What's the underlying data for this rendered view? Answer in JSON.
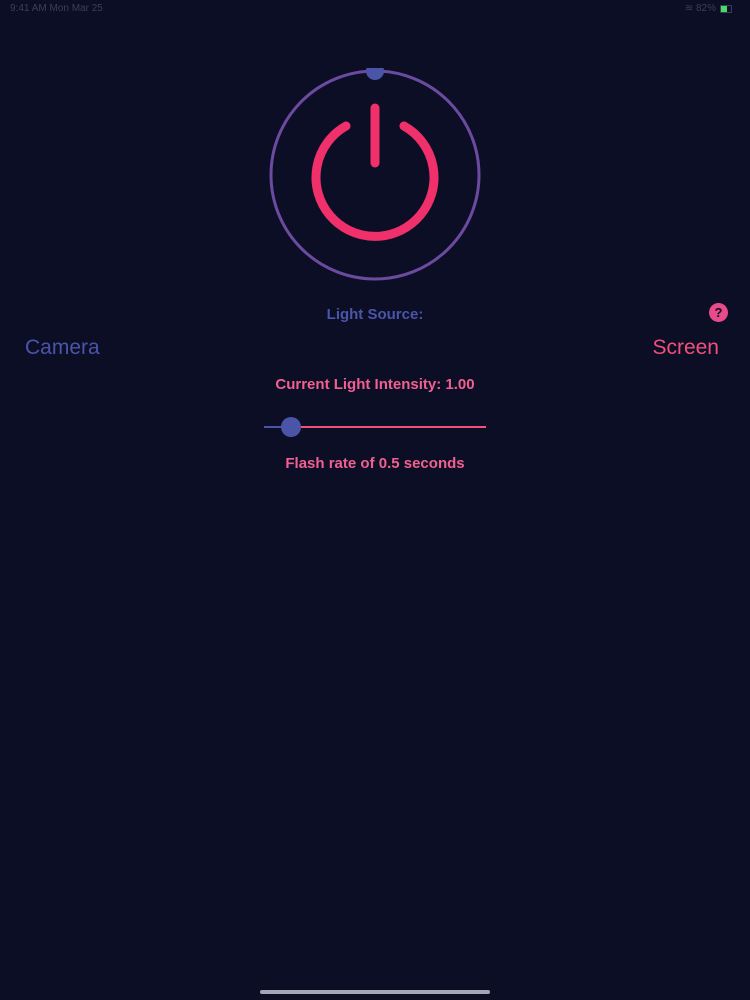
{
  "status_bar": {
    "time": "9:41 AM  Mon Mar 25",
    "signal": "≋ 82%"
  },
  "power_dial": {
    "state": "on",
    "icon": "power-icon",
    "ring_color": "#6b4aa0",
    "power_color": "#f0306a",
    "knob_color": "#4a55a8"
  },
  "light_source": {
    "label": "Light Source:",
    "help": "?",
    "options": [
      "Camera",
      "Screen"
    ],
    "selected": "Screen"
  },
  "intensity": {
    "label": "Current Light Intensity: 1.00",
    "slider_value": 0.12
  },
  "flash_rate": {
    "label": "Flash rate of 0.5 seconds"
  },
  "colors": {
    "background": "#0c0e26",
    "accent_blue": "#4a55a8",
    "accent_pink": "#f0507a"
  }
}
